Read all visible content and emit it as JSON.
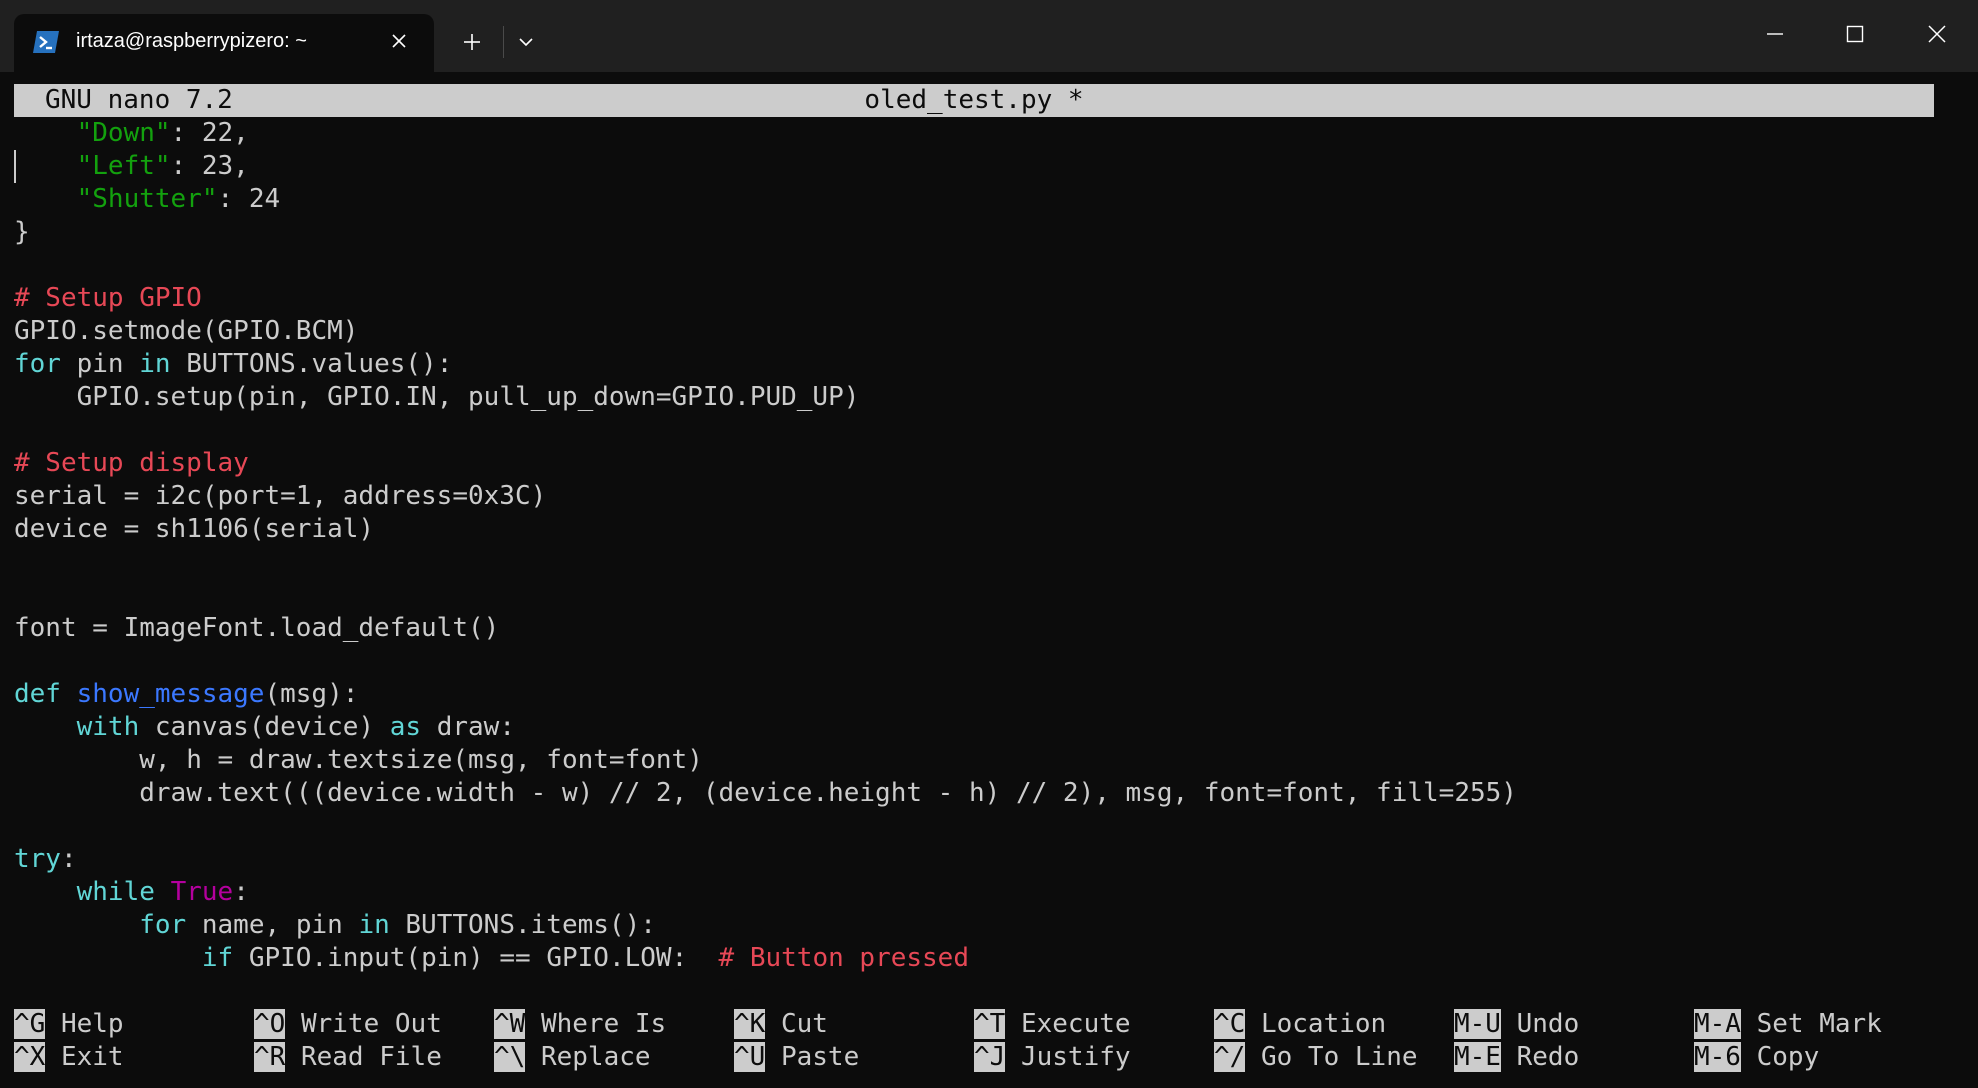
{
  "window": {
    "tab_title": "irtaza@raspberrypizero: ~"
  },
  "nano": {
    "version": "GNU nano 7.2",
    "filename": "oled_test.py *"
  },
  "code_lines": [
    "    \"Down\": 22,",
    "    \"Left\": 23,",
    "    \"Shutter\": 24",
    "}",
    "",
    "# Setup GPIO",
    "GPIO.setmode(GPIO.BCM)",
    "for pin in BUTTONS.values():",
    "    GPIO.setup(pin, GPIO.IN, pull_up_down=GPIO.PUD_UP)",
    "",
    "# Setup display",
    "serial = i2c(port=1, address=0x3C)",
    "device = sh1106(serial)",
    "",
    "",
    "font = ImageFont.load_default()",
    "",
    "def show_message(msg):",
    "    with canvas(device) as draw:",
    "        w, h = draw.textsize(msg, font=font)",
    "        draw.text(((device.width - w) // 2, (device.height - h) // 2), msg, font=font, fill=255)",
    "",
    "try:",
    "    while True:",
    "        for name, pin in BUTTONS.items():",
    "            if GPIO.input(pin) == GPIO.LOW:  # Button pressed"
  ],
  "shortcuts": [
    {
      "key": "^G",
      "label": "Help"
    },
    {
      "key": "^X",
      "label": "Exit"
    },
    {
      "key": "^O",
      "label": "Write Out"
    },
    {
      "key": "^R",
      "label": "Read File"
    },
    {
      "key": "^W",
      "label": "Where Is"
    },
    {
      "key": "^\\",
      "label": "Replace"
    },
    {
      "key": "^K",
      "label": "Cut"
    },
    {
      "key": "^U",
      "label": "Paste"
    },
    {
      "key": "^T",
      "label": "Execute"
    },
    {
      "key": "^J",
      "label": "Justify"
    },
    {
      "key": "^C",
      "label": "Location"
    },
    {
      "key": "^/",
      "label": "Go To Line"
    },
    {
      "key": "M-U",
      "label": "Undo"
    },
    {
      "key": "M-E",
      "label": "Redo"
    },
    {
      "key": "M-A",
      "label": "Set Mark"
    },
    {
      "key": "M-6",
      "label": "Copy"
    }
  ],
  "colors": {
    "string": "#13a10e",
    "comment": "#e74856",
    "keyword": "#61d6d6",
    "function": "#3b78ff",
    "constant": "#b4009e"
  }
}
